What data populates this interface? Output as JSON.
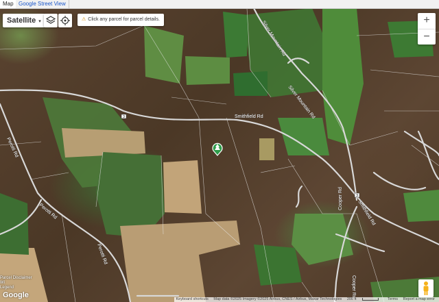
{
  "tabs": [
    {
      "label": "Map"
    },
    {
      "label": "Google Street View"
    }
  ],
  "controls": {
    "map_type": "Satellite",
    "notice": "Click any parcel for parcel details.",
    "zoom_in": "+",
    "zoom_out": "−"
  },
  "roads": {
    "smithfield_1": "Smithfield Rd",
    "smithfield_2": "Smithfield Rd",
    "silver_mountain_1": "Silver Mountain Rd",
    "silver_mountain_2": "Silver Mountain Rd",
    "perotti_1": "Perotti Rd",
    "perotti_2": "Perotti Rd",
    "perotti_3": "Perotti Rd",
    "cooper_1": "Cooper Rd",
    "cooper_2": "Cooper Rd",
    "route_shield_1": "3",
    "route_shield_2": "3"
  },
  "overlay": {
    "parcel_disclaimer": "Parcel Disclaimer",
    "parcel_line2": "Wi",
    "parcel_line3": "Legend",
    "google": "Google"
  },
  "attribution": {
    "keyboard": "Keyboard shortcuts",
    "map_data": "Map data ©2025 Imagery ©2025 Airbus, CNES / Airbus, Maxar Technologies",
    "scale": "200 ft",
    "terms": "Terms",
    "report": "Report a map error"
  },
  "icons": {
    "layers": "layers-icon",
    "locate": "locate-icon",
    "warning": "warning-icon",
    "marker": "park-marker-icon",
    "pegman": "pegman-icon"
  },
  "colors": {
    "road": "#d8d8d8",
    "parcel_line": "#e8e8e8",
    "marker": "#2e9c4a"
  }
}
